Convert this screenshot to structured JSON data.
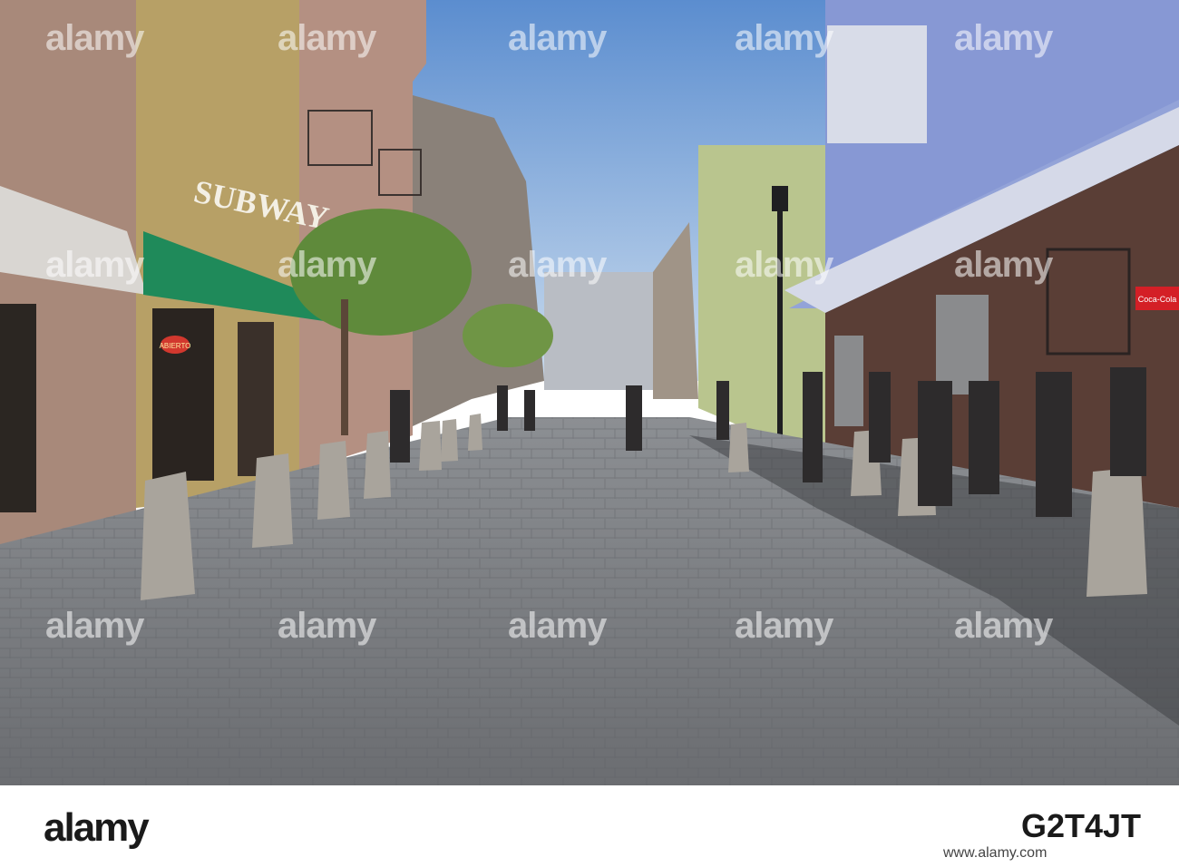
{
  "scene": {
    "storefront": {
      "sign_text": "SUBWAY",
      "neon_text": "ABIERTO"
    },
    "soda_sign_text": "Coca-Cola"
  },
  "watermark": {
    "text": "alamy"
  },
  "footer": {
    "logo_text": "alamy",
    "image_id": "G2T4JT",
    "url": "www.alamy.com"
  },
  "colors": {
    "sky": "#6f9fd6",
    "pavement": "#7a7d82",
    "awning_green": "#1f8a5a",
    "building_blue": "#93a3d8"
  }
}
